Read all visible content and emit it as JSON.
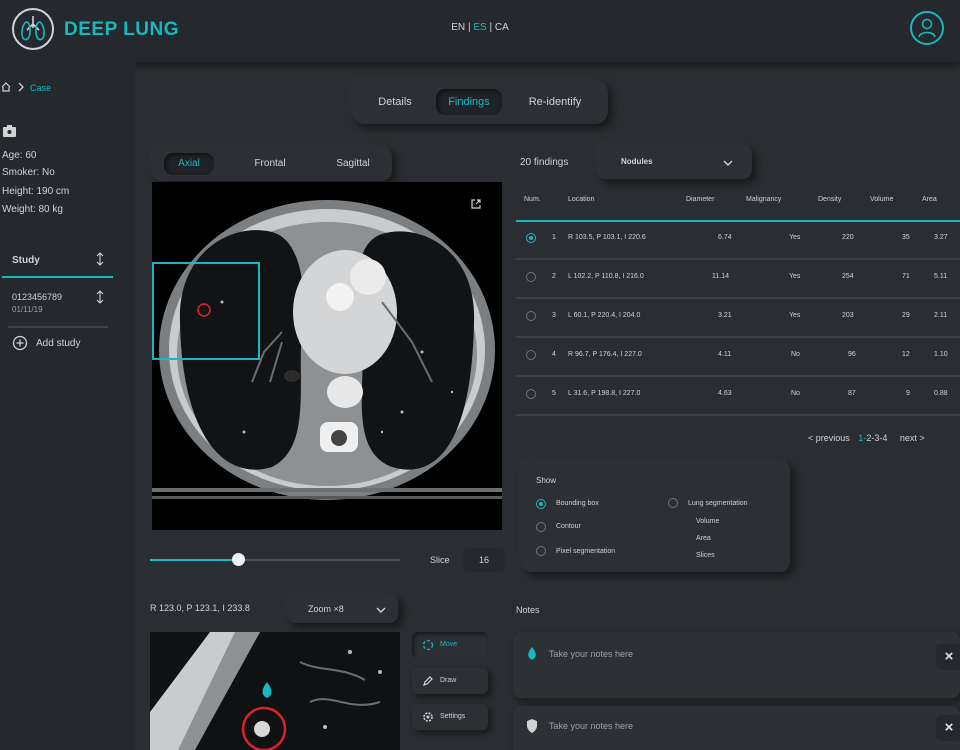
{
  "header": {
    "app_title": "DEEP LUNG",
    "lang_en": "EN",
    "lang_es": "ES",
    "lang_ca": "CA",
    "lang_sep": "|"
  },
  "sidebar": {
    "breadcrumb": "Case",
    "patient": {
      "age": "Age: 60",
      "smoker": "Smoker: No",
      "height": "Height: 190 cm",
      "weight": "Weight: 80 kg"
    },
    "study_header": "Study",
    "study_id": "0123456789",
    "study_date": "01/11/19",
    "add_study": "Add study"
  },
  "tabs": {
    "details": "Details",
    "findings": "Findings",
    "reidentify": "Re-identify"
  },
  "views": {
    "axial": "Axial",
    "frontal": "Frontal",
    "sagittal": "Sagittal"
  },
  "slice": {
    "label": "Slice",
    "value": "16",
    "progress": 0.35
  },
  "coords": "R 123.0, P 123.1, I 233.8",
  "zoom": {
    "selected": "Zoom ×8"
  },
  "tools": {
    "move": "Move",
    "draw": "Draw",
    "settings": "Settings"
  },
  "findings": {
    "count": "20 findings",
    "filter": "Nodules",
    "columns": [
      "Num.",
      "Location",
      "Diameter",
      "Malignancy",
      "Density",
      "Volume",
      "Area"
    ],
    "rows": [
      {
        "num": "1",
        "location": "R 103.5, P 103.1, I 220.6",
        "diameter": "6.74",
        "malignancy": "Yes",
        "density": "220",
        "volume": "35",
        "area": "3.27",
        "selected": true
      },
      {
        "num": "2",
        "location": "L 102.2, P 110.8, I 216.0",
        "diameter": "11.14",
        "malignancy": "Yes",
        "density": "254",
        "volume": "71",
        "area": "5.11",
        "selected": false
      },
      {
        "num": "3",
        "location": "L 60.1, P 220.4, I 204.0",
        "diameter": "3.21",
        "malignancy": "Yes",
        "density": "203",
        "volume": "29",
        "area": "2.11",
        "selected": false
      },
      {
        "num": "4",
        "location": "R 96.7, P 176.4, I 227.0",
        "diameter": "4.11",
        "malignancy": "No",
        "density": "96",
        "volume": "12",
        "area": "1.10",
        "selected": false
      },
      {
        "num": "5",
        "location": "L 31.6, P 198.8, I 227.0",
        "diameter": "4.63",
        "malignancy": "No",
        "density": "87",
        "volume": "9",
        "area": "0.88",
        "selected": false
      }
    ],
    "pagination": {
      "previous": "< previous",
      "pages": [
        "1",
        "2",
        "3",
        "4"
      ],
      "separator": "-",
      "next": "next >"
    }
  },
  "show": {
    "title": "Show",
    "options": [
      "Bounding box",
      "Contour",
      "Pixel segmentation"
    ],
    "lung_segmentation": "Lung segmentation",
    "metrics": [
      "Volume",
      "Area",
      "Slices"
    ]
  },
  "notes": {
    "title": "Notes",
    "placeholder": "Take your notes here",
    "close": "×"
  },
  "colors": {
    "accent": "#19b8c0",
    "background": "#2a2d31",
    "panel": "#25282c",
    "marker": "#d9232e"
  },
  "icons": [
    "lungs-logo-icon",
    "user-icon",
    "home-icon",
    "chevron-right-icon",
    "id-card-icon",
    "sort-icon",
    "add-circle-icon",
    "expand-icon",
    "chevron-down-icon",
    "move-icon",
    "pencil-icon",
    "settings-icon",
    "drop-icon",
    "shield-icon",
    "close-icon"
  ]
}
